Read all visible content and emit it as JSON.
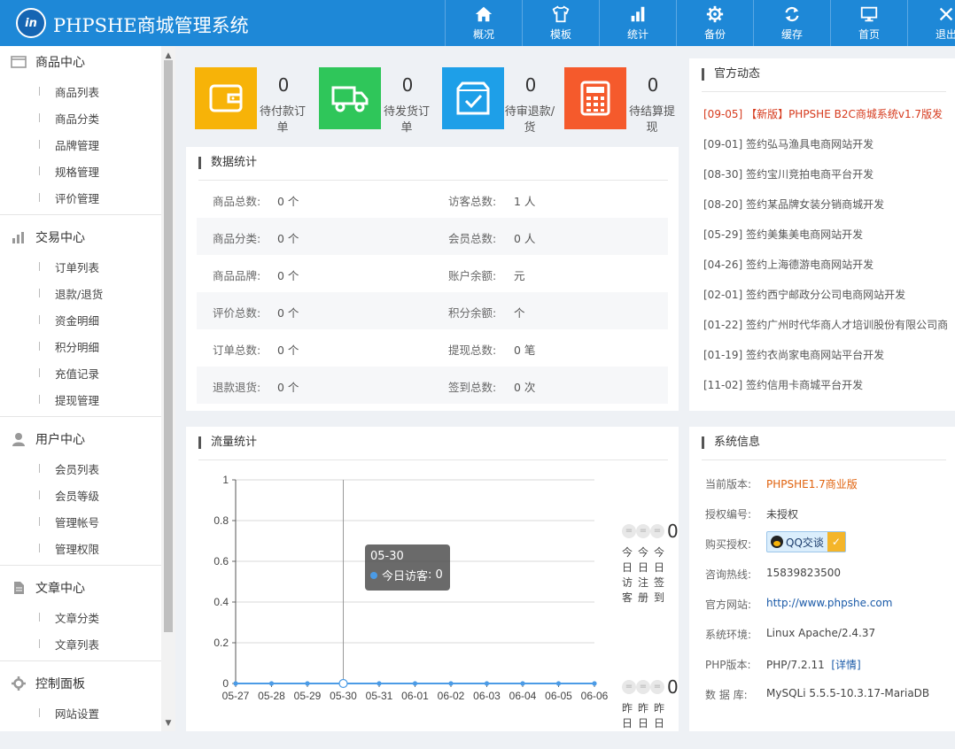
{
  "header": {
    "logo_text": "in",
    "title": "PHPSHE商城管理系统",
    "nav": [
      {
        "label": "概况",
        "icon": "home-icon"
      },
      {
        "label": "模板",
        "icon": "shirt-icon"
      },
      {
        "label": "统计",
        "icon": "bar-chart-icon"
      },
      {
        "label": "备份",
        "icon": "gear-icon"
      },
      {
        "label": "缓存",
        "icon": "refresh-icon"
      },
      {
        "label": "首页",
        "icon": "monitor-icon"
      },
      {
        "label": "退出",
        "icon": "close-icon"
      }
    ]
  },
  "sidebar": {
    "groups": [
      {
        "title": "商品中心",
        "icon": "folder-icon",
        "items": [
          "商品列表",
          "商品分类",
          "品牌管理",
          "规格管理",
          "评价管理"
        ]
      },
      {
        "title": "交易中心",
        "icon": "bar-chart-icon",
        "items": [
          "订单列表",
          "退款/退货",
          "资金明细",
          "积分明细",
          "充值记录",
          "提现管理"
        ]
      },
      {
        "title": "用户中心",
        "icon": "user-icon",
        "items": [
          "会员列表",
          "会员等级",
          "管理帐号",
          "管理权限"
        ]
      },
      {
        "title": "文章中心",
        "icon": "document-icon",
        "items": [
          "文章分类",
          "文章列表"
        ]
      },
      {
        "title": "控制面板",
        "icon": "gear-icon",
        "items": [
          "网站设置"
        ]
      }
    ]
  },
  "stats": [
    {
      "value": "0",
      "label": "待付款订单",
      "color": "#f7b308",
      "icon": "wallet-icon"
    },
    {
      "value": "0",
      "label": "待发货订单",
      "color": "#2fc65a",
      "icon": "truck-icon"
    },
    {
      "value": "0",
      "label": "待审退款/货",
      "color": "#1e9fe8",
      "icon": "checkbox-icon"
    },
    {
      "value": "0",
      "label": "待结算提现",
      "color": "#f55a2c",
      "icon": "calculator-icon"
    }
  ],
  "data_stats": {
    "title": "数据统计",
    "rows": [
      {
        "k1": "商品总数:",
        "v1": "0 个",
        "k2": "访客总数:",
        "v2": "1 人"
      },
      {
        "k1": "商品分类:",
        "v1": "0 个",
        "k2": "会员总数:",
        "v2": "0 人"
      },
      {
        "k1": "商品品牌:",
        "v1": "0 个",
        "k2": "账户余额:",
        "v2": "元"
      },
      {
        "k1": "评价总数:",
        "v1": "0 个",
        "k2": "积分余额:",
        "v2": "个"
      },
      {
        "k1": "订单总数:",
        "v1": "0 个",
        "k2": "提现总数:",
        "v2": "0 笔"
      },
      {
        "k1": "退款退货:",
        "v1": "0 个",
        "k2": "签到总数:",
        "v2": "0 次"
      }
    ]
  },
  "news": {
    "title": "官方动态",
    "items": [
      {
        "date": "[09-05]",
        "text": "【新版】PHPSHE B2C商城系统v1.7版发",
        "highlight": true
      },
      {
        "date": "[09-01]",
        "text": "签约弘马渔具电商网站开发",
        "highlight": false
      },
      {
        "date": "[08-30]",
        "text": "签约宝川竞拍电商平台开发",
        "highlight": false
      },
      {
        "date": "[08-20]",
        "text": "签约某品牌女装分销商城开发",
        "highlight": false
      },
      {
        "date": "[05-29]",
        "text": "签约美集美电商网站开发",
        "highlight": false
      },
      {
        "date": "[04-26]",
        "text": "签约上海德游电商网站开发",
        "highlight": false
      },
      {
        "date": "[02-01]",
        "text": "签约西宁邮政分公司电商网站开发",
        "highlight": false
      },
      {
        "date": "[01-22]",
        "text": "签约广州时代华商人才培训股份有限公司商",
        "highlight": false
      },
      {
        "date": "[01-19]",
        "text": "签约衣尚家电商网站平台开发",
        "highlight": false
      },
      {
        "date": "[11-02]",
        "text": "签约信用卡商城平台开发",
        "highlight": false
      }
    ]
  },
  "traffic": {
    "title": "流量统计",
    "today": {
      "value": "0",
      "labels": [
        "今日访客",
        "今日注册",
        "今日签到"
      ]
    },
    "yesterday": {
      "value": "0",
      "labels": [
        "昨日",
        "昨日",
        "昨日"
      ]
    },
    "tooltip": {
      "date": "05-30",
      "series": "今日访客",
      "value": "0"
    }
  },
  "chart_data": {
    "type": "line",
    "x": [
      "05-27",
      "05-28",
      "05-29",
      "05-30",
      "05-31",
      "06-01",
      "06-02",
      "06-03",
      "06-04",
      "06-05",
      "06-06"
    ],
    "series": [
      {
        "name": "今日访客",
        "values": [
          0,
          0,
          0,
          0,
          0,
          0,
          0,
          0,
          0,
          0,
          0
        ]
      }
    ],
    "yticks": [
      "0",
      "0.2",
      "0.4",
      "0.6",
      "0.8",
      "1"
    ],
    "ylim": [
      0,
      1
    ],
    "line_color": "#4b9be6"
  },
  "sysinfo": {
    "title": "系统信息",
    "rows": [
      {
        "k": "当前版本:",
        "v": "PHPSHE1.7商业版",
        "color": "#e0620d"
      },
      {
        "k": "授权编号:",
        "v": "未授权",
        "color": "#444"
      },
      {
        "k": "购买授权:",
        "v": "QQ交谈",
        "color": "#444"
      },
      {
        "k": "咨询热线:",
        "v": "15839823500",
        "color": "#444"
      },
      {
        "k": "官方网站:",
        "v": "http://www.phpshe.com",
        "color": "#1a5aa8"
      },
      {
        "k": "系统环境:",
        "v": "Linux Apache/2.4.37",
        "color": "#444"
      },
      {
        "k": "PHP版本:",
        "v": "PHP/7.2.11",
        "color": "#444"
      },
      {
        "k": "数 据 库:",
        "v": "MySQLi 5.5.5-10.3.17-MariaDB",
        "color": "#444"
      }
    ],
    "detail_link": "[详情]"
  }
}
